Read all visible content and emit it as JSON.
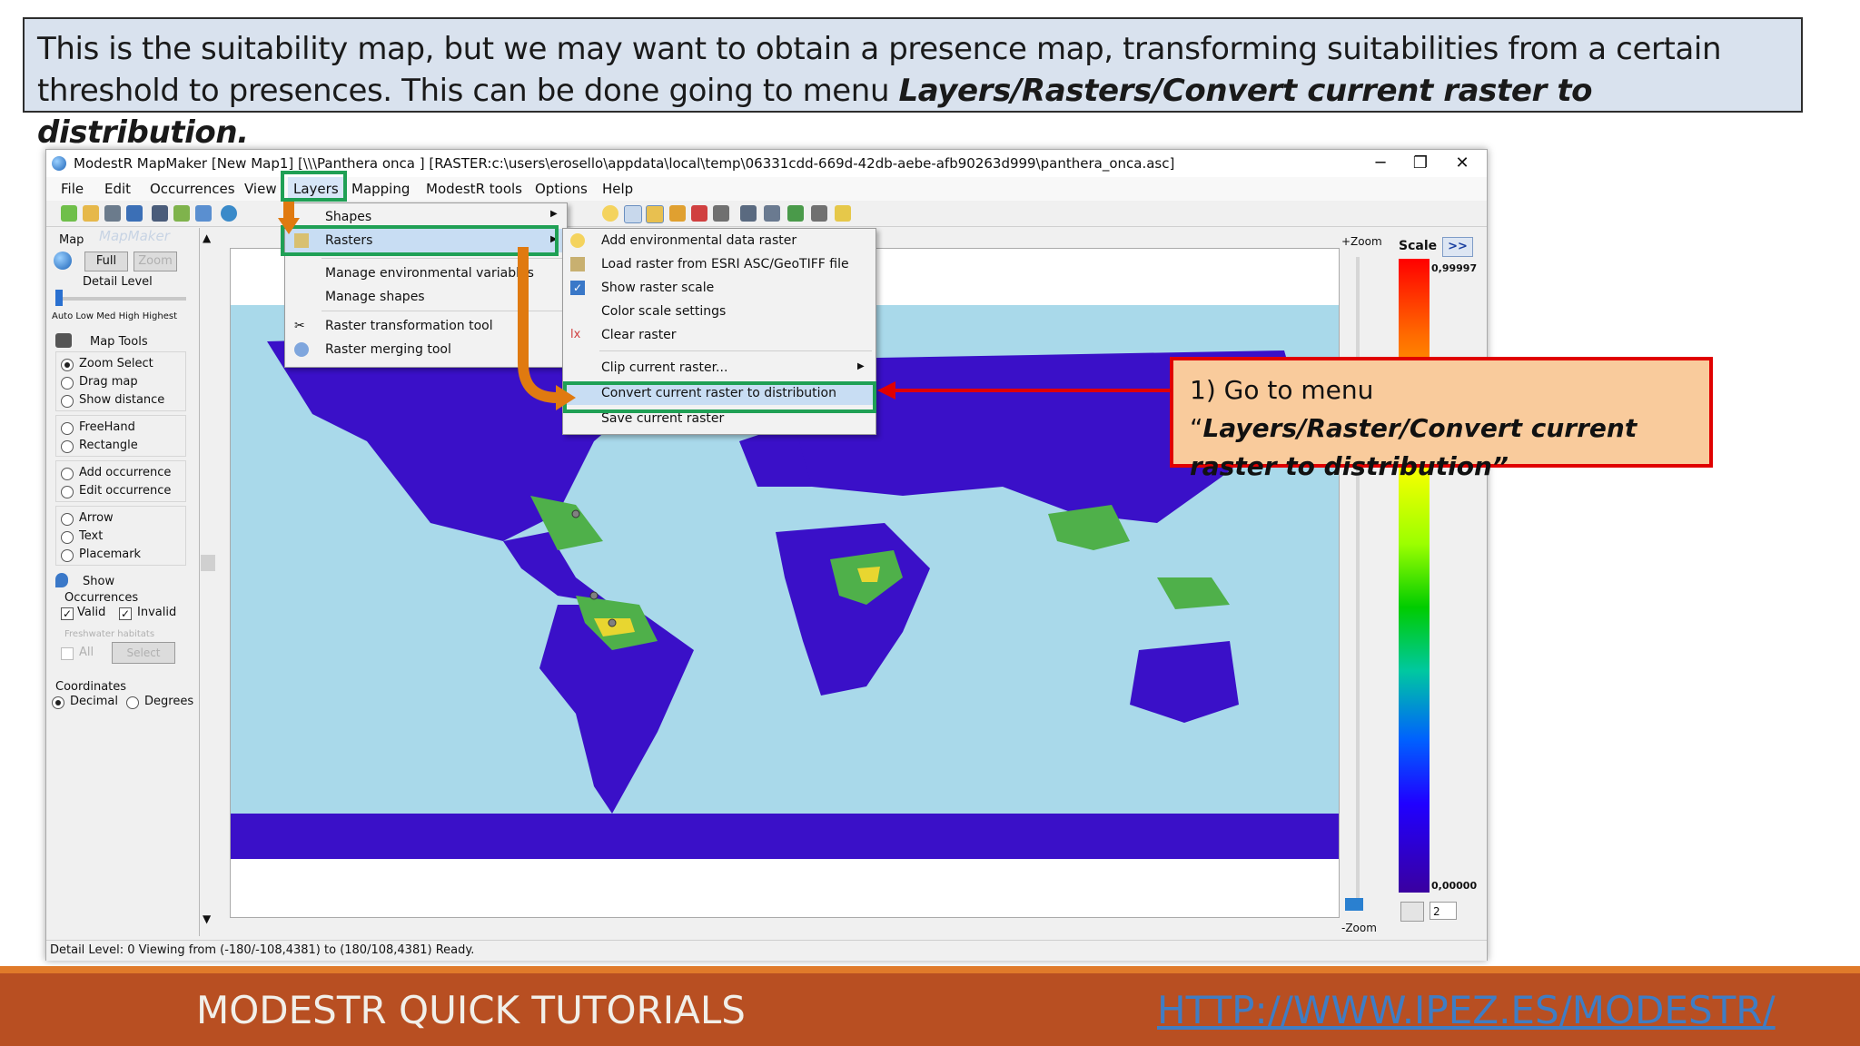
{
  "caption": {
    "text": "This is the suitability map, but we may want to obtain a presence map, transforming suitabilities from a certain threshold to presences. This can be done going to menu ",
    "emphasis": "Layers/Rasters/Convert current raster to distribution."
  },
  "window": {
    "title": "ModestR MapMaker [New Map1] [\\\\\\Panthera onca ] [RASTER:c:\\users\\erosello\\appdata\\local\\temp\\06331cdd-669d-42db-aebe-afb90263d999\\panthera_onca.asc]",
    "controls": [
      "─",
      "❐",
      "✕"
    ]
  },
  "menubar": [
    "File",
    "Edit",
    "Occurrences",
    "View",
    "Layers",
    "Mapping",
    "ModestR tools",
    "Options",
    "Help"
  ],
  "left_panel": {
    "map_label": "Map",
    "logo_text": "MapMaker",
    "full_button": "Full",
    "zoom_button": "Zoom",
    "detail_level_label": "Detail Level",
    "detail_levels": "Auto Low Med High Highest",
    "map_tools_label": "Map Tools",
    "tool_group_1": [
      "Zoom Select",
      "Drag map",
      "Show distance"
    ],
    "tool_group_2": [
      "FreeHand",
      "Rectangle"
    ],
    "tool_group_3": [
      "Add occurrence",
      "Edit occurrence"
    ],
    "tool_group_4": [
      "Arrow",
      "Text",
      "Placemark"
    ],
    "show_label": "Show",
    "occurrences_label": "Occurrences",
    "valid_label": "Valid",
    "invalid_label": "Invalid",
    "freshwater_label": "Freshwater habitats",
    "all_label": "All",
    "select_button": "Select",
    "coordinates_label": "Coordinates",
    "decimal_label": "Decimal",
    "degrees_label": "Degrees"
  },
  "zoom": {
    "plus": "+Zoom",
    "minus": "-Zoom"
  },
  "scale_panel": {
    "title": "Scale",
    "expand": ">>",
    "max": "0,99997",
    "min": "0,00000",
    "spinner_value": "2"
  },
  "status_bar": {
    "text": "Detail Level: 0  Viewing from (-180/-108,4381) to (180/108,4381)  Ready."
  },
  "layers_menu": [
    "Shapes",
    "Rasters",
    "Manage environmental variables",
    "Manage shapes",
    "Raster transformation tool",
    "Raster merging tool"
  ],
  "rasters_submenu": [
    "Add environmental data raster",
    "Load raster from ESRI ASC/GeoTIFF file",
    "Show raster scale",
    "Color scale settings",
    "Clear raster",
    "Clip current raster...",
    "Convert current raster to distribution",
    "Save current raster"
  ],
  "callout": {
    "prefix": "1) Go to menu “",
    "emphasis": "Layers/Raster/Convert current raster to distribution”"
  },
  "footer": {
    "title": "MODESTR QUICK TUTORIALS",
    "link": "HTTP://WWW.IPEZ.ES/MODESTR/"
  },
  "colors": {
    "accent_green": "#1fa055",
    "callout_red": "#e00000",
    "callout_fill": "#f9cb9c",
    "footer": "#b84f22",
    "ocean": "#a9d9ea",
    "land_low": "#3a10c8"
  }
}
